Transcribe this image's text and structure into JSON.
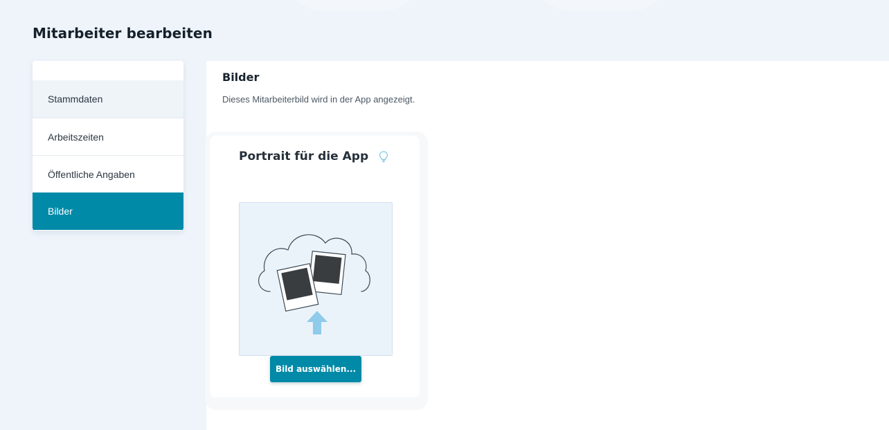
{
  "page": {
    "title": "Mitarbeiter bearbeiten"
  },
  "sidebar": {
    "items": [
      {
        "label": "Stammdaten"
      },
      {
        "label": "Arbeitszeiten"
      },
      {
        "label": "Öffentliche Angaben"
      },
      {
        "label": "Bilder",
        "active": true
      }
    ]
  },
  "section": {
    "title": "Bilder",
    "description": "Dieses Mitarbeiterbild wird in der App angezeigt."
  },
  "portrait_card": {
    "title": "Portrait für die App",
    "hint_icon": "lightbulb-icon",
    "illustration_icon": "photo-upload-cloud-icon",
    "button_label": "Bild auswählen..."
  },
  "colors": {
    "accent": "#008aa8",
    "page_background": "#eef4fa",
    "dropzone_background": "#ebf3fa",
    "upload_arrow": "#8fcbea"
  }
}
